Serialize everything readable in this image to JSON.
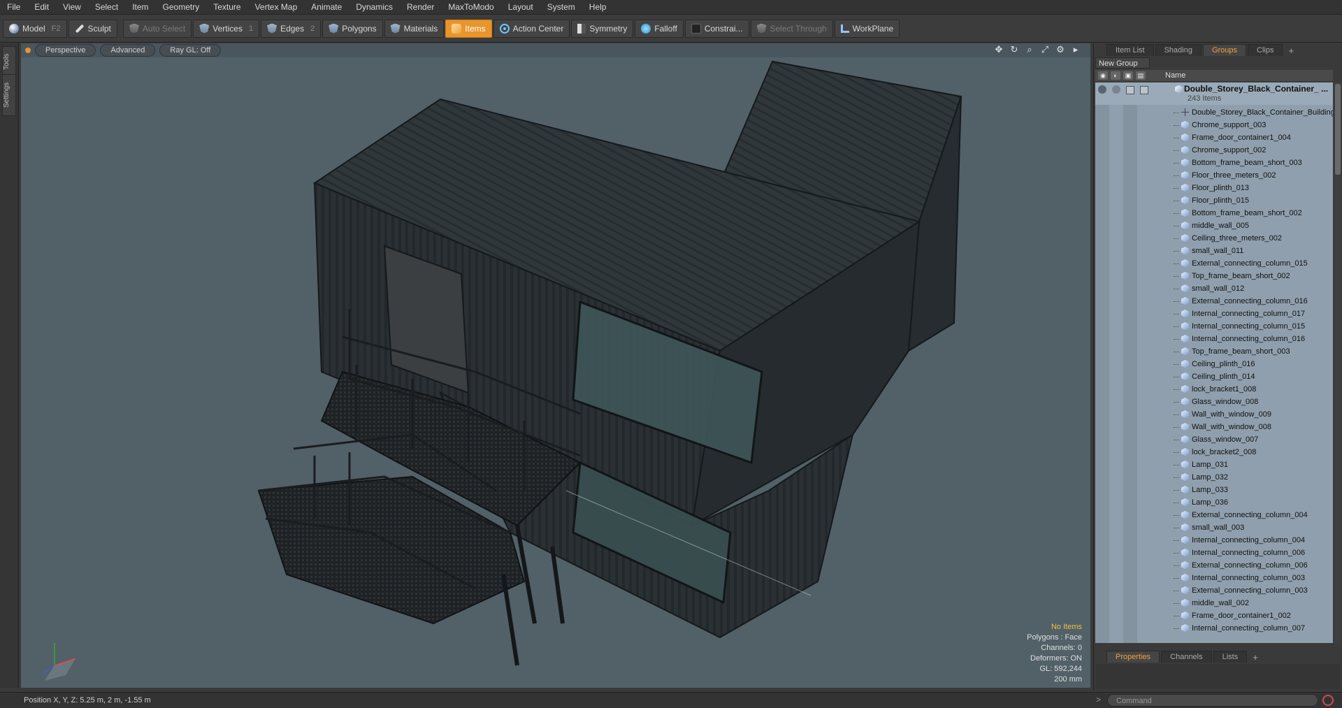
{
  "menu": [
    "File",
    "Edit",
    "View",
    "Select",
    "Item",
    "Geometry",
    "Texture",
    "Vertex Map",
    "Animate",
    "Dynamics",
    "Render",
    "MaxToModo",
    "Layout",
    "System",
    "Help"
  ],
  "toolbar": {
    "model": "Model",
    "model_key": "F2",
    "sculpt": "Sculpt",
    "auto_select": "Auto Select",
    "vertices": "Vertices",
    "vertices_key": "1",
    "edges": "Edges",
    "edges_key": "2",
    "polygons": "Polygons",
    "materials": "Materials",
    "items": "Items",
    "action_center": "Action Center",
    "symmetry": "Symmetry",
    "falloff": "Falloff",
    "constraints": "Constrai...",
    "select_through": "Select Through",
    "workplane": "WorkPlane"
  },
  "left_tabs": [
    "Tools",
    "Settings"
  ],
  "viewport": {
    "view_mode": "Perspective",
    "shading": "Advanced",
    "raygl": "Ray GL: Off",
    "stats": {
      "selection": "No Items",
      "polygons": "Polygons : Face",
      "channels": "Channels: 0",
      "deformers": "Deformers: ON",
      "gl": "GL: 592,244",
      "scale": "200 mm"
    }
  },
  "status": {
    "position": "Position X, Y, Z:   5.25 m, 2 m, -1.55 m",
    "command_placeholder": "Command",
    "prompt": ">"
  },
  "right_panel": {
    "tabs": [
      "Item List",
      "Shading",
      "Groups",
      "Clips"
    ],
    "active_tab": "Groups",
    "new_group": "New Group",
    "col_name": "Name",
    "group": {
      "name": "Double_Storey_Black_Container_ ...",
      "count": "243 Items"
    },
    "items": [
      "Double_Storey_Black_Container_Building",
      "Chrome_support_003",
      "Frame_door_container1_004",
      "Chrome_support_002",
      "Bottom_frame_beam_short_003",
      "Floor_three_meters_002",
      "Floor_plinth_013",
      "Floor_plinth_015",
      "Bottom_frame_beam_short_002",
      "middle_wall_005",
      "Ceiling_three_meters_002",
      "small_wall_011",
      "External_connecting_column_015",
      "Top_frame_beam_short_002",
      "small_wall_012",
      "External_connecting_column_016",
      "Internal_connecting_column_017",
      "Internal_connecting_column_015",
      "Internal_connecting_column_016",
      "Top_frame_beam_short_003",
      "Ceiling_plinth_016",
      "Ceiling_plinth_014",
      "lock_bracket1_008",
      "Glass_window_008",
      "Wall_with_window_009",
      "Wall_with_window_008",
      "Glass_window_007",
      "lock_bracket2_008",
      "Lamp_031",
      "Lamp_032",
      "Lamp_033",
      "Lamp_036",
      "External_connecting_column_004",
      "small_wall_003",
      "Internal_connecting_column_004",
      "Internal_connecting_column_006",
      "External_connecting_column_006",
      "Internal_connecting_column_003",
      "External_connecting_column_003",
      "middle_wall_002",
      "Frame_door_container1_002",
      "Internal_connecting_column_007"
    ],
    "bottom_tabs": [
      "Properties",
      "Channels",
      "Lists"
    ],
    "bottom_active": "Properties"
  },
  "colors": {
    "accent": "#e8952c",
    "viewport_bg": "#526068",
    "list_bg": "#8f9fad"
  }
}
